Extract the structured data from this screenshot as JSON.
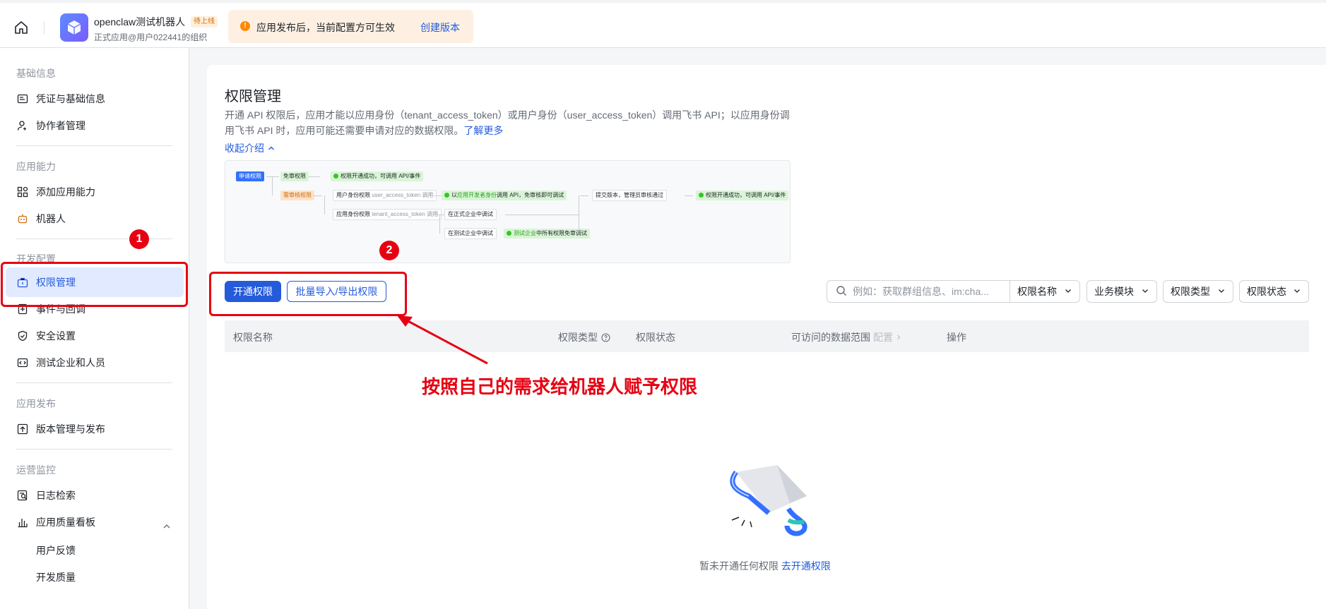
{
  "topbar": {
    "app_name": "openclaw测试机器人",
    "badge": "待上线",
    "app_sub": "正式应用@用户022441的组织",
    "notice_text": "应用发布后，当前配置方可生效",
    "notice_link": "创建版本"
  },
  "sidebar": {
    "groups": [
      {
        "title": "基础信息",
        "items": [
          "凭证与基础信息",
          "协作者管理"
        ]
      },
      {
        "title": "应用能力",
        "items": [
          "添加应用能力",
          "机器人"
        ]
      },
      {
        "title": "开发配置",
        "items": [
          "权限管理",
          "事件与回调",
          "安全设置",
          "测试企业和人员"
        ]
      },
      {
        "title": "应用发布",
        "items": [
          "版本管理与发布"
        ]
      },
      {
        "title": "运营监控",
        "items": [
          "日志检索",
          "应用质量看板"
        ],
        "subitems": [
          "用户反馈",
          "开发质量"
        ]
      }
    ],
    "active": "权限管理"
  },
  "main": {
    "title": "权限管理",
    "desc_line1": "开通 API 权限后，应用才能以应用身份（tenant_access_token）或用户身份（user_access_token）调用飞书 API；以应用身份调",
    "desc_line2": "用飞书 API 时，应用可能还需要申请对应的数据权限。",
    "learn_more": "了解更多",
    "collapse": "收起介绍",
    "flow": {
      "apply": "申请权限",
      "no_review": "免审权限",
      "success": "权限开通成功，可调用 API/事件",
      "review": "需审核权限",
      "user_perm": "用户身份权限",
      "user_token": "user_access_token 调用",
      "dev_prefix": "以",
      "dev_mid": "应用开发者身份",
      "dev_suffix": "调用 API，免审核即可调试",
      "submit": "提交版本，管理员审核通过",
      "success2": "权限开通成功，可调用 API/事件",
      "app_perm": "应用身份权限",
      "tenant_token": "tenant_access_token 调用",
      "formal": "在正式企业中调试",
      "test": "在测试企业中调试",
      "test_ent": "测试企业",
      "test_suffix": "中所有权限免审调试"
    },
    "btn_open": "开通权限",
    "btn_batch": "批量导入/导出权限",
    "search_placeholder": "例如：获取群组信息、im:cha...",
    "filters": [
      "权限名称",
      "业务模块",
      "权限类型",
      "权限状态"
    ],
    "columns": {
      "name": "权限名称",
      "type": "权限类型",
      "status": "权限状态",
      "scope": "可访问的数据范围",
      "config": "配置",
      "ops": "操作"
    },
    "empty_text": "暂未开通任何权限",
    "empty_link": "去开通权限"
  },
  "annotations": {
    "num1": "1",
    "num2": "2",
    "text": "按照自己的需求给机器人赋予权限",
    "color": "#e60012"
  },
  "colors": {
    "accent": "#245bdb",
    "notice_bg": "#fdf0e2"
  }
}
